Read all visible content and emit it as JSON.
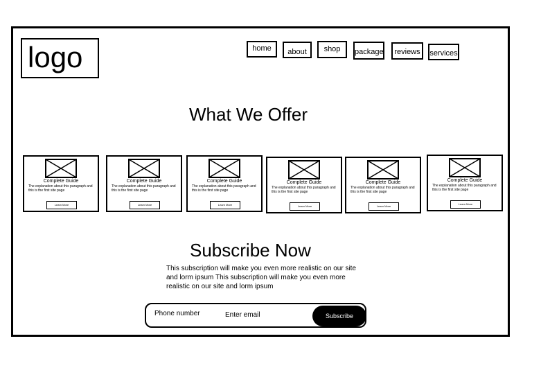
{
  "header": {
    "logo_text": "logo",
    "nav": [
      "home",
      "about",
      "shop",
      "package",
      "reviews",
      "services"
    ]
  },
  "offer": {
    "heading": "What We Offer",
    "cards": [
      {
        "title": "Complete Guide",
        "description": "The explanation about this paragraph and this is the first site page",
        "button": "Learn More"
      },
      {
        "title": "Complete Guide",
        "description": "The explanation about this paragraph and this is the first site page",
        "button": "Learn More"
      },
      {
        "title": "Complete Guide",
        "description": "The explanation about this paragraph and this is the first site page",
        "button": "Learn More"
      },
      {
        "title": "Complete Guide",
        "description": "The explanation about this paragraph and this is the first site page",
        "button": "Learn More"
      },
      {
        "title": "Complete Guide",
        "description": "The explanation about this paragraph and this is the first site page",
        "button": "Learn More"
      },
      {
        "title": "Complete Guide",
        "description": "The explanation about this paragraph and this is the first site page",
        "button": "Learn More"
      }
    ]
  },
  "subscribe": {
    "heading": "Subscribe Now",
    "text": "This subscription will make you even more realistic on our site and lorm ipsum This subscription will make you even more realistic on our site and lorm ipsum",
    "phone_label": "Phone number",
    "email_placeholder": "Enter email",
    "button": "Subscribe"
  }
}
